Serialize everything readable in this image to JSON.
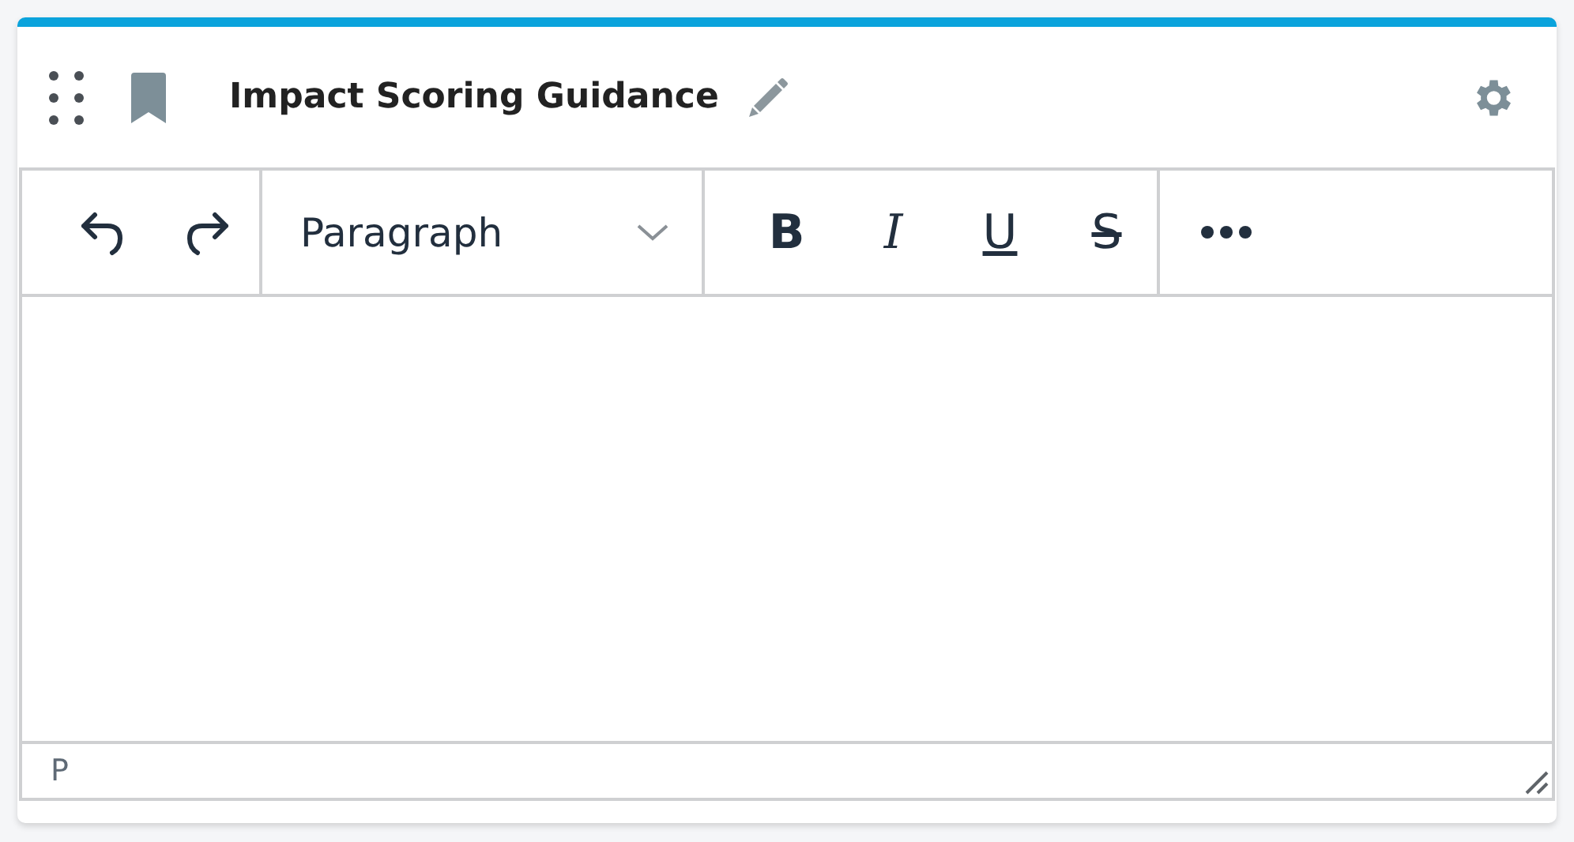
{
  "panel": {
    "title": "Impact Scoring Guidance"
  },
  "toolbar": {
    "block_format": "Paragraph",
    "format_buttons": [
      {
        "kind": "bold",
        "label": "B"
      },
      {
        "kind": "italic",
        "label": "I"
      },
      {
        "kind": "underline",
        "label": "U"
      },
      {
        "kind": "strikethrough",
        "label": "S"
      }
    ]
  },
  "status_bar": {
    "path": "P"
  }
}
